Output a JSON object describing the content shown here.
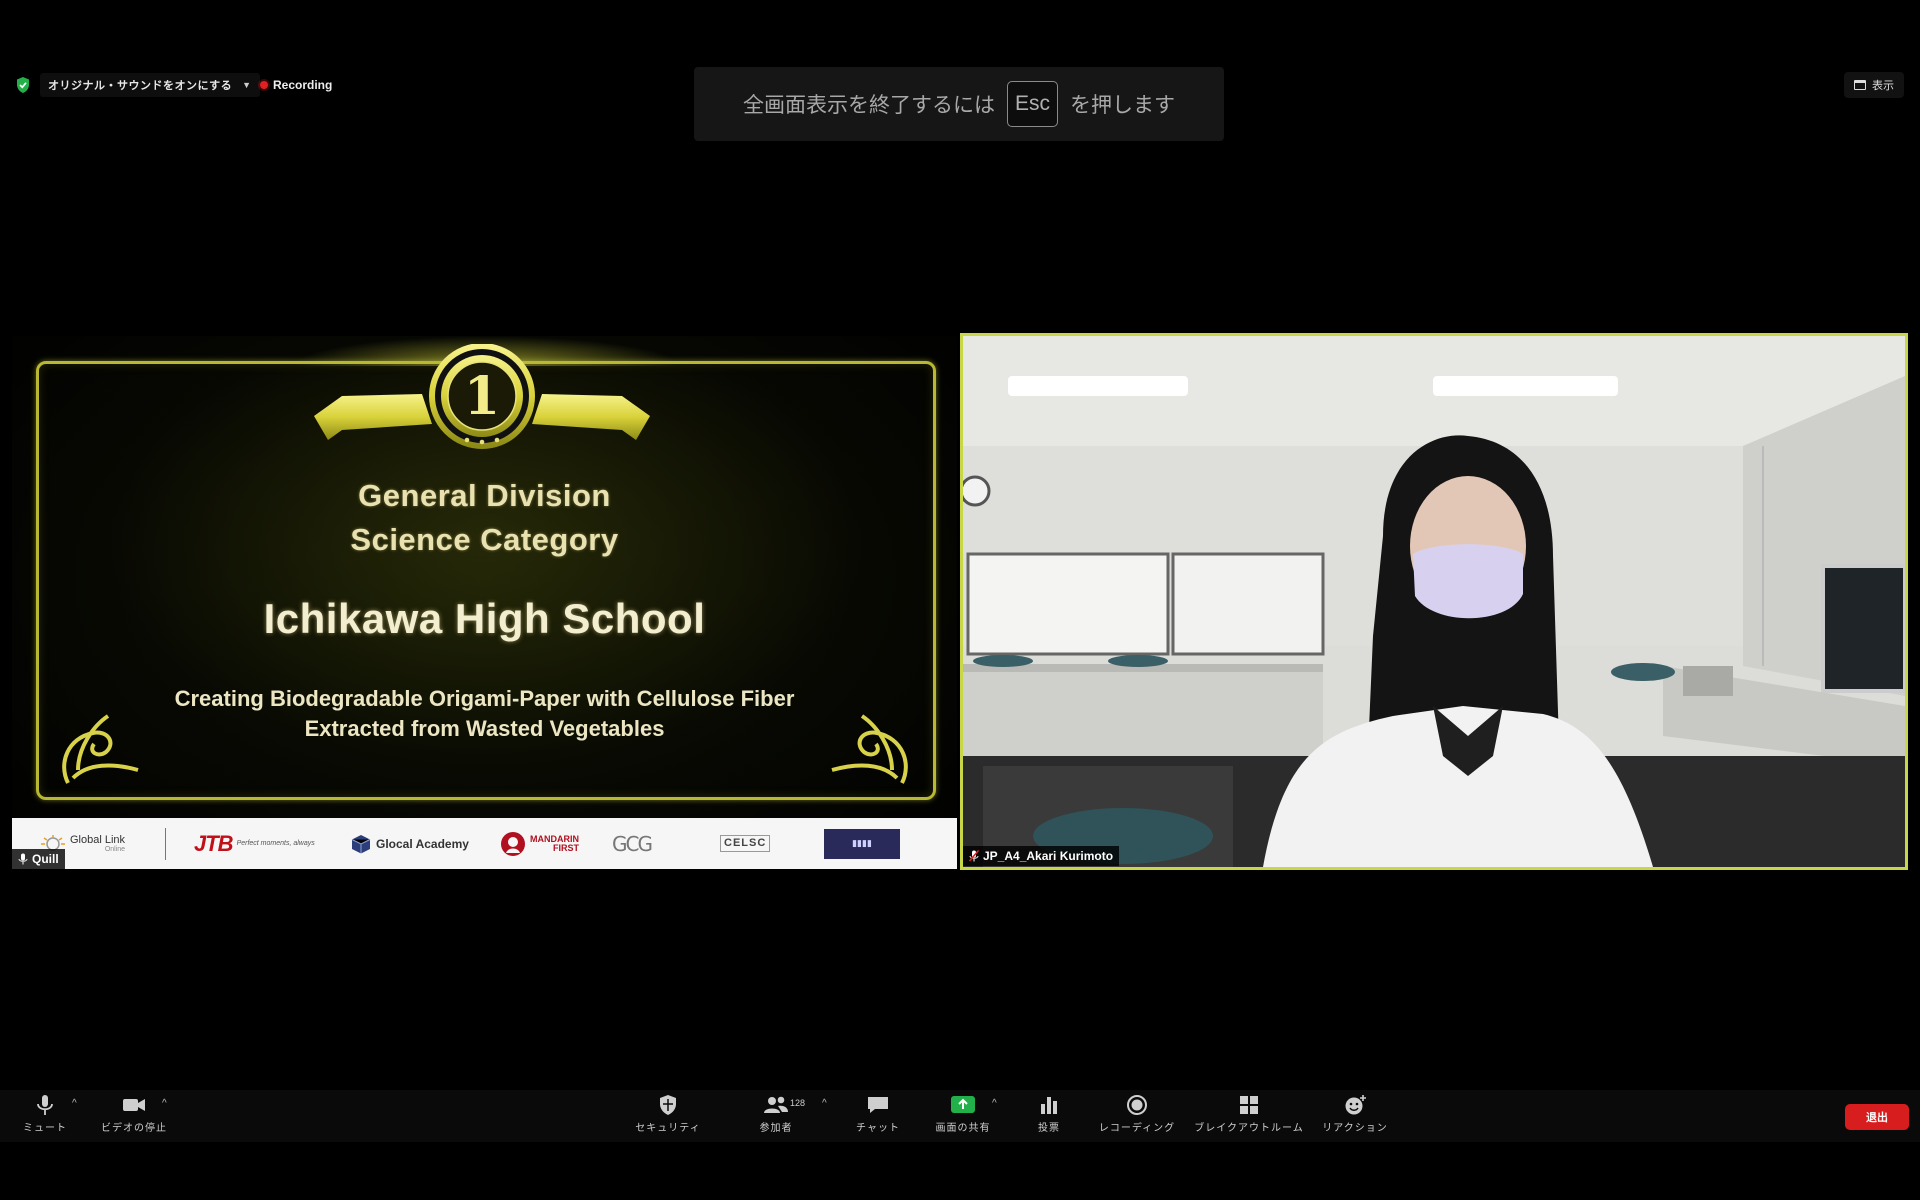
{
  "top_bar": {
    "sound_toggle_label": "オリジナル・サウンドをオンにする",
    "recording_label": "Recording",
    "view_label": "表示"
  },
  "fullscreen_notice": {
    "before": "全画面表示を終了するには",
    "key": "Esc",
    "after": "を押します"
  },
  "shared_screen": {
    "medal_number": "1",
    "division": "General Division",
    "category": "Science Category",
    "school": "Ichikawa High School",
    "title_line1": "Creating Biodegradable Origami-Paper with Cellulose Fiber",
    "title_line2": "Extracted from Wasted Vegetables",
    "sponsors": {
      "global_link": "Global Link",
      "global_link_sub": "Online",
      "jtb": "JTB",
      "jtb_tagline": "Perfect moments, always",
      "glocal": "Glocal Academy",
      "mandarin_1": "MANDARIN",
      "mandarin_2": "FIRST",
      "gcg": "GCG",
      "celsc": "CELSC"
    },
    "presenter_name": "Quill"
  },
  "camera_tile": {
    "participant_name": "JP_A4_Akari Kurimoto"
  },
  "toolbar": {
    "mute": "ミュート",
    "video": "ビデオの停止",
    "security": "セキュリティ",
    "participants": "参加者",
    "participant_count": "128",
    "chat": "チャット",
    "share": "画面の共有",
    "polls": "投票",
    "recording": "レコーディング",
    "breakout": "ブレイクアウトルーム",
    "reactions": "リアクション",
    "leave": "退出"
  },
  "colors": {
    "active_speaker_border": "#c9d646",
    "share_green": "#22b04a",
    "leave_red": "#d71d1d",
    "recording_red": "#e02020",
    "award_gold": "#b8b832"
  }
}
